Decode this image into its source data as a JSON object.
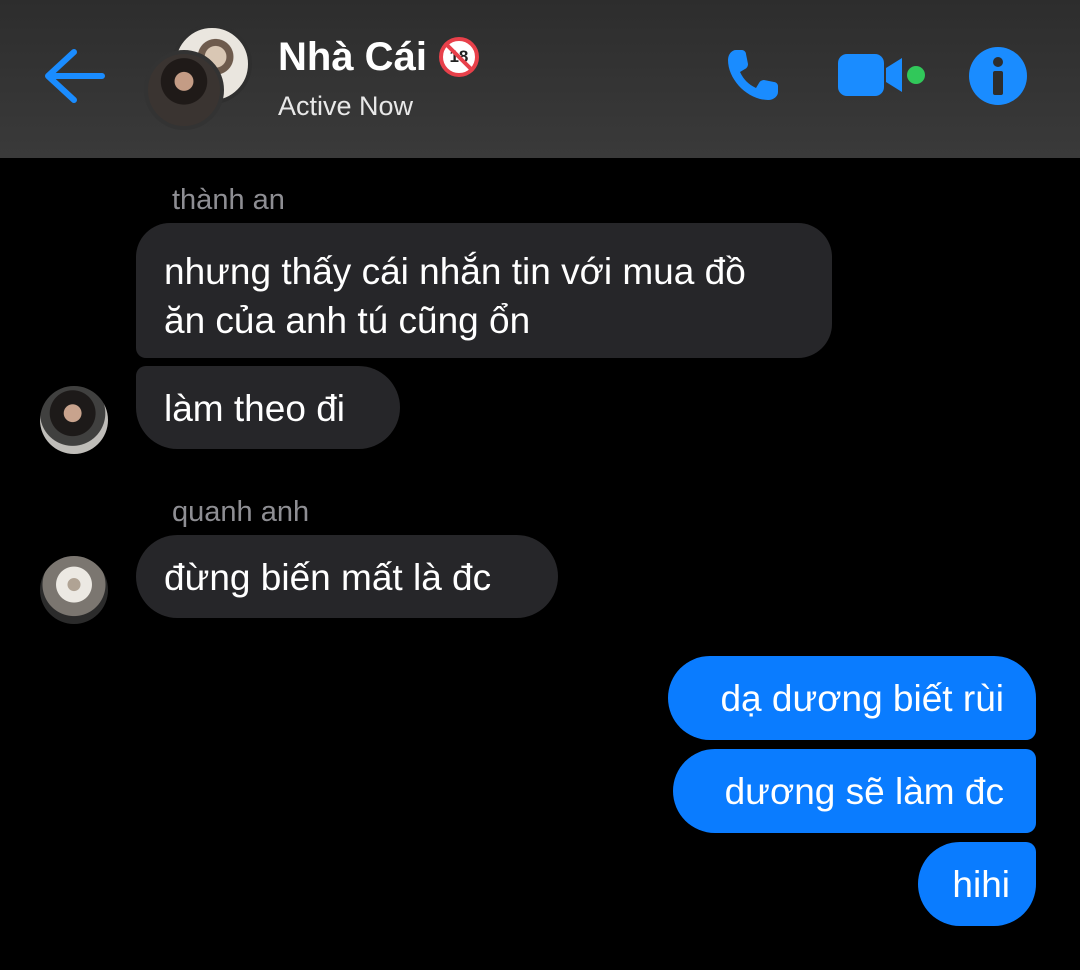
{
  "header": {
    "title": "Nhà Cái",
    "badge_text": "18",
    "status": "Active Now",
    "back_icon": "back-arrow-icon",
    "call_icon": "phone-icon",
    "video_icon": "video-camera-icon",
    "info_icon": "info-icon",
    "accent_color": "#1a8cff",
    "online_dot_color": "#31c85a"
  },
  "messages": [
    {
      "sender": "thành an",
      "lines": [
        "nhưng thấy cái nhắn tin với mua đồ",
        "ăn của anh tú cũng ổn"
      ]
    },
    {
      "text": "làm theo đi"
    },
    {
      "sender": "quanh anh",
      "text": "đừng biến mất là đc"
    },
    {
      "text": "dạ dương biết rùi"
    },
    {
      "text": "dương sẽ làm đc"
    },
    {
      "text": "hihi"
    }
  ],
  "colors": {
    "incoming_bubble": "#262629",
    "outgoing_bubble": "#0a7cff",
    "sender_name": "#8e8e93"
  }
}
